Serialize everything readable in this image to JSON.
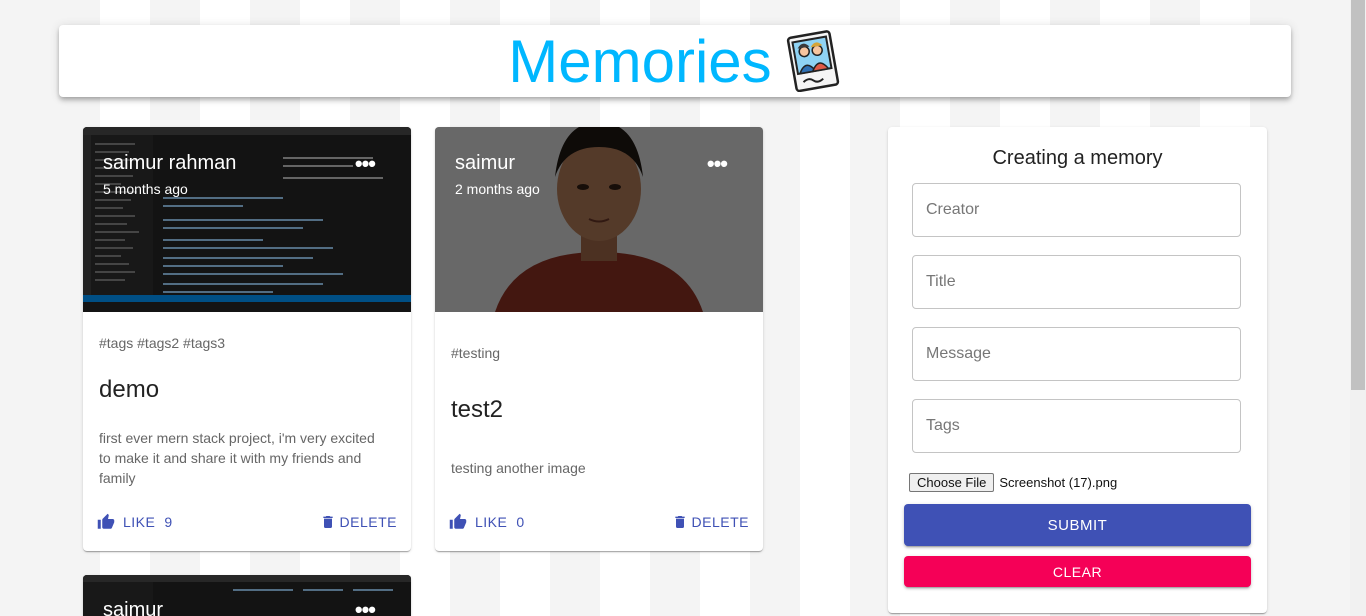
{
  "app": {
    "title": "Memories",
    "brand_color": "#00b7ff",
    "logo_icon": "photo-memories-icon"
  },
  "posts": [
    {
      "creator": "saimur rahman",
      "time": "5 months ago",
      "tags": "#tags #tags2 #tags3",
      "title": "demo",
      "message": "first ever mern stack project, i'm very excited to make it and share it with my friends and family",
      "like_label": "LIKE",
      "like_count": "9",
      "delete_label": "DELETE",
      "image_kind": "code-editor-screenshot"
    },
    {
      "creator": "saimur",
      "time": "2 months ago",
      "tags": "#testing",
      "title": "test2",
      "message": "testing another image",
      "like_label": "LIKE",
      "like_count": "0",
      "delete_label": "DELETE",
      "image_kind": "portrait-photo"
    },
    {
      "creator": "saimur",
      "image_kind": "code-editor-screenshot"
    }
  ],
  "form": {
    "title": "Creating a memory",
    "creator_placeholder": "Creator",
    "title_placeholder": "Title",
    "message_placeholder": "Message",
    "tags_placeholder": "Tags",
    "choose_file_label": "Choose File",
    "file_name": "Screenshot (17).png",
    "submit_label": "SUBMIT",
    "clear_label": "CLEAR",
    "submit_color": "#3f51b5",
    "clear_color": "#f50057"
  }
}
